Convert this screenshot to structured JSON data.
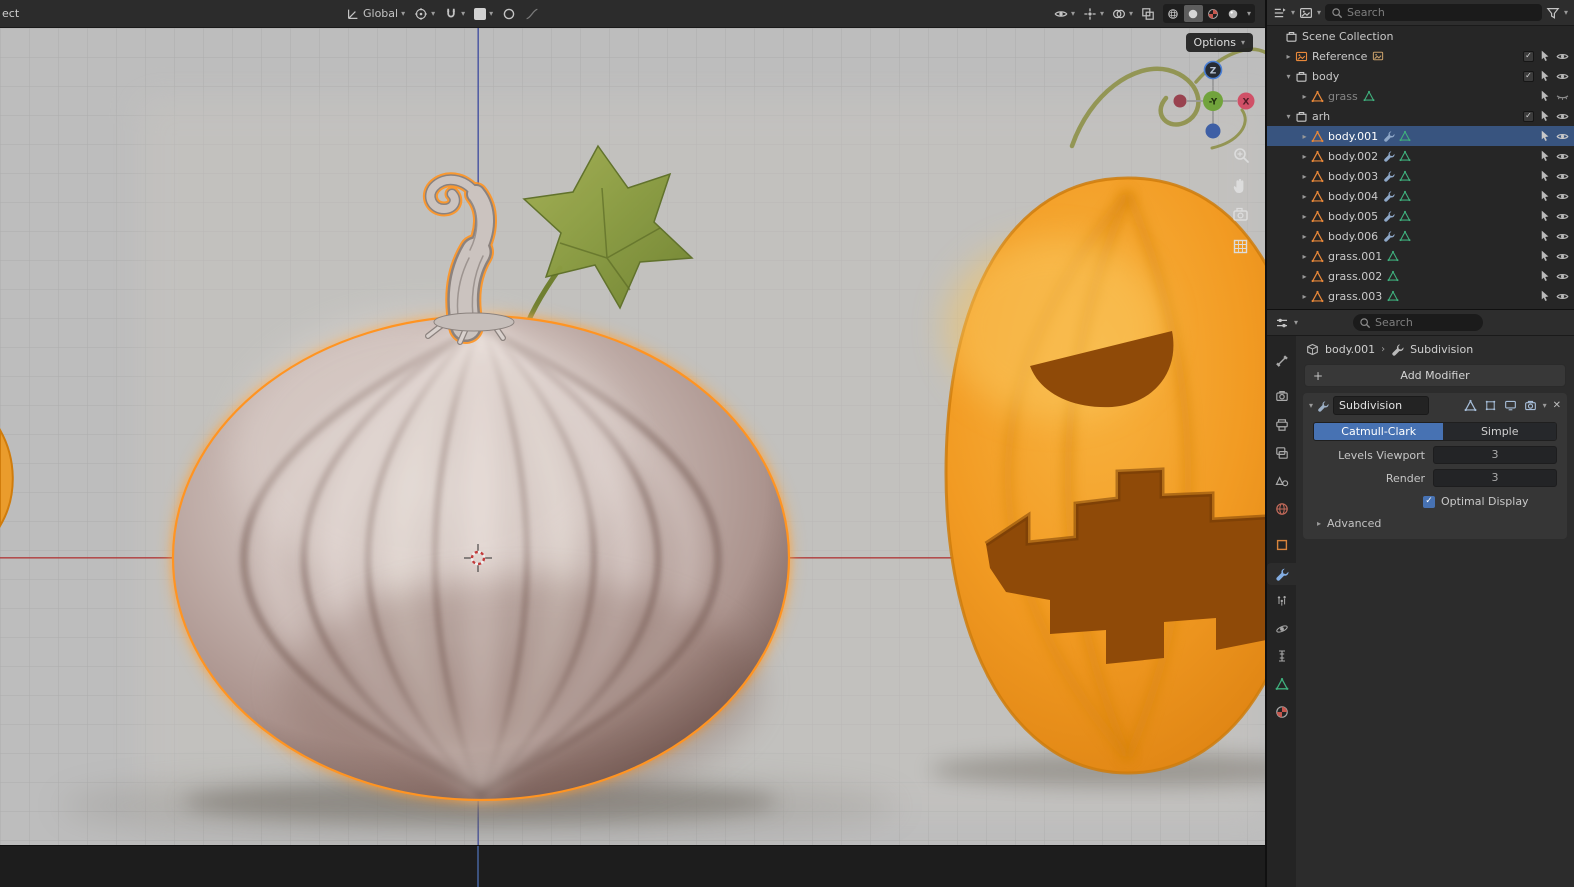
{
  "topbar": {
    "clipped_left": "ect",
    "orientation_label": "Global",
    "options_label": "Options"
  },
  "gizmo": {
    "z_label": "Z",
    "y_label": "-Y",
    "x_label": "X"
  },
  "icons": {
    "chev_down": "▾",
    "chev_right": "▸",
    "close": "✕",
    "plus": "+",
    "check": "✓",
    "crumb_sep": "›"
  },
  "outliner": {
    "search_placeholder": "Search",
    "selected": "body.001",
    "rows": [
      {
        "label": "Scene Collection",
        "type": "scene-collection"
      },
      {
        "label": "Reference",
        "type": "empty-image"
      },
      {
        "label": "body",
        "type": "collection"
      },
      {
        "label": "grass",
        "type": "mesh-object",
        "hidden": true
      },
      {
        "label": "arh",
        "type": "collection"
      },
      {
        "label": "body.001",
        "type": "mesh-object",
        "selected": true
      },
      {
        "label": "body.002",
        "type": "mesh-object"
      },
      {
        "label": "body.003",
        "type": "mesh-object"
      },
      {
        "label": "body.004",
        "type": "mesh-object"
      },
      {
        "label": "body.005",
        "type": "mesh-object"
      },
      {
        "label": "body.006",
        "type": "mesh-object"
      },
      {
        "label": "grass.001",
        "type": "mesh-object"
      },
      {
        "label": "grass.002",
        "type": "mesh-object"
      },
      {
        "label": "grass.003",
        "type": "mesh-object"
      }
    ]
  },
  "properties": {
    "search_placeholder": "Search",
    "breadcrumb": {
      "object": "body.001",
      "modifier": "Subdivision"
    },
    "add_modifier_label": "Add Modifier",
    "modifier_panel": {
      "name": "Subdivision",
      "options": [
        "Catmull-Clark",
        "Simple"
      ],
      "selected_option": "Catmull-Clark",
      "levels_viewport_label": "Levels Viewport",
      "levels_viewport_value": "3",
      "render_label": "Render",
      "render_value": "3",
      "optimal_display_label": "Optimal Display",
      "optimal_display_checked": true,
      "advanced_label": "Advanced"
    }
  },
  "colors": {
    "accent_blue": "#4772b3",
    "selection_orange": "#ff9422",
    "object_orange": "#e8883a",
    "mesh_data_green": "#3fae7c",
    "axis_x_red": "#d05067",
    "axis_y_green": "#71a33c",
    "axis_z_blue": "#4a7fd4"
  }
}
